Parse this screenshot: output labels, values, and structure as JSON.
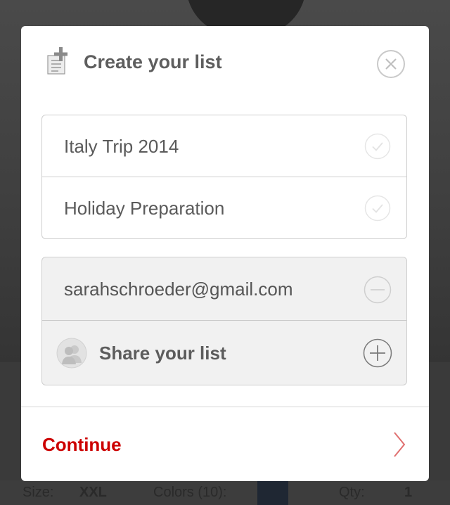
{
  "modal": {
    "title": "Create your list",
    "lists": [
      {
        "label": "Italy Trip 2014"
      },
      {
        "label": "Holiday Preparation"
      }
    ],
    "share": {
      "email": "sarahschroeder@gmail.com",
      "share_label": "Share your list"
    },
    "continue_label": "Continue"
  },
  "background_bar": {
    "size_label": "Size:",
    "size_value": "XXL",
    "colors_label": "Colors (10):",
    "qty_label": "Qty:",
    "qty_value": "1"
  },
  "colors": {
    "accent": "#cc0000",
    "chevron": "#e07070",
    "text": "#5a5a5a",
    "share_bg": "#f1f1f1"
  },
  "icons": {
    "header": "add-list-icon",
    "close": "close-icon",
    "row_check": "checkmark-icon",
    "remove": "minus-circle-icon",
    "add": "plus-circle-icon",
    "avatar": "users-avatar-icon",
    "continue": "chevron-right-icon"
  }
}
